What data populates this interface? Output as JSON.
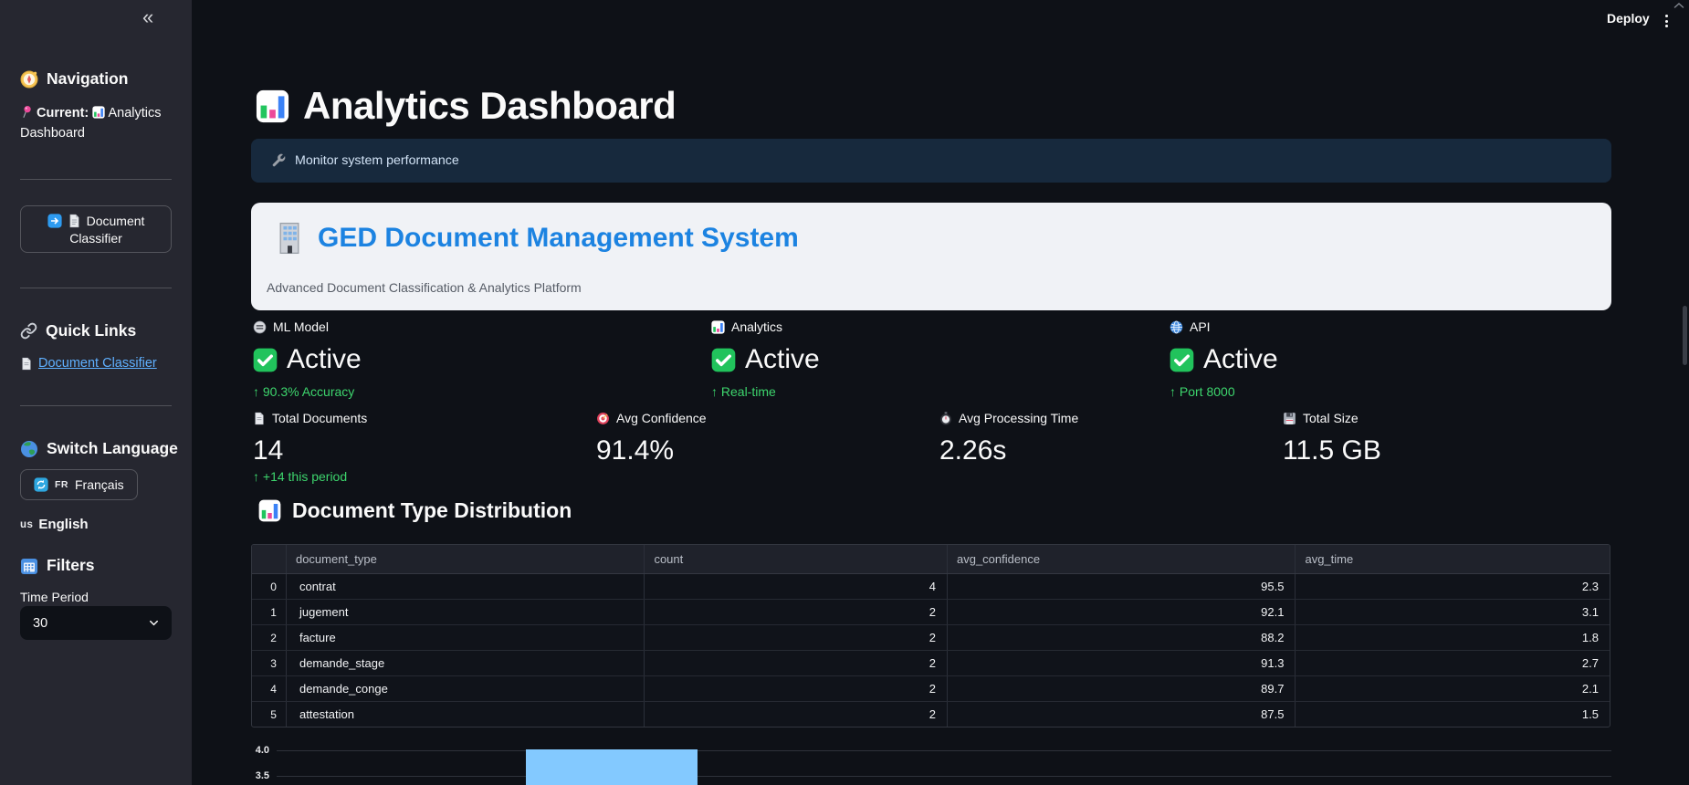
{
  "topbar": {
    "deploy_label": "Deploy"
  },
  "sidebar": {
    "collapse_glyph": "«",
    "navigation_heading": "Navigation",
    "current_label": "Current:",
    "current_value": "Analytics Dashboard",
    "classifier_button_line1": "Document",
    "classifier_button_line2": "Classifier",
    "quick_links_heading": "Quick Links",
    "quick_link_text": "Document Classifier",
    "language_heading": "Switch Language",
    "language_button_flag": "FR",
    "language_button_text": "Français",
    "language_current_flag": "us",
    "language_current_text": "English",
    "filters_heading": "Filters",
    "time_period_label": "Time Period",
    "time_period_value": "30"
  },
  "main": {
    "title": "Analytics Dashboard",
    "info_banner": "Monitor system performance",
    "hero_title": "GED Document Management System",
    "hero_subtitle": "Advanced Document Classification & Analytics Platform",
    "status_cards": [
      {
        "label": "ML Model",
        "value": "Active",
        "delta": "↑ 90.3% Accuracy"
      },
      {
        "label": "Analytics",
        "value": "Active",
        "delta": "↑ Real-time"
      },
      {
        "label": "API",
        "value": "Active",
        "delta": "↑ Port 8000"
      }
    ],
    "metrics": [
      {
        "label": "Total Documents",
        "value": "14",
        "delta": "↑ +14 this period"
      },
      {
        "label": "Avg Confidence",
        "value": "91.4%"
      },
      {
        "label": "Avg Processing Time",
        "value": "2.26s"
      },
      {
        "label": "Total Size",
        "value": "11.5 GB"
      }
    ],
    "section_heading": "Document Type Distribution",
    "table": {
      "columns": [
        "document_type",
        "count",
        "avg_confidence",
        "avg_time"
      ],
      "rows": [
        {
          "index": "0",
          "document_type": "contrat",
          "count": "4",
          "avg_confidence": "95.5",
          "avg_time": "2.3"
        },
        {
          "index": "1",
          "document_type": "jugement",
          "count": "2",
          "avg_confidence": "92.1",
          "avg_time": "3.1"
        },
        {
          "index": "2",
          "document_type": "facture",
          "count": "2",
          "avg_confidence": "88.2",
          "avg_time": "1.8"
        },
        {
          "index": "3",
          "document_type": "demande_stage",
          "count": "2",
          "avg_confidence": "91.3",
          "avg_time": "2.7"
        },
        {
          "index": "4",
          "document_type": "demande_conge",
          "count": "2",
          "avg_confidence": "89.7",
          "avg_time": "2.1"
        },
        {
          "index": "5",
          "document_type": "attestation",
          "count": "2",
          "avg_confidence": "87.5",
          "avg_time": "1.5"
        }
      ]
    },
    "chart_ticks": [
      "4.0",
      "3.5"
    ]
  },
  "chart_data": {
    "type": "bar",
    "note": "bar chart cut off at bottom edge of screenshot; only top of tallest bar visible",
    "visible_y_ticks": [
      4.0,
      3.5
    ],
    "visible_bar_values": [
      4
    ],
    "bar_color": "#83c9ff",
    "grid": true
  },
  "icons": {
    "collapse": "«",
    "navigation": "compass 🧭",
    "current-pin": "round pushpin 📍",
    "bar-chart": "bar chart 📊",
    "arrow-right": "right arrow ➡️",
    "document": "page 📄",
    "quick-links": "link 🔗",
    "globe": "globe 🌍",
    "refresh": "arrows 🔄",
    "calendar": "calendar 📅",
    "ml-model": "robot 🤖",
    "api": "globe with meridians 🌐",
    "active-check": "check mark ✅",
    "target": "bullseye 🎯",
    "stopwatch": "stopwatch ⏱️",
    "floppy": "floppy disk 💾",
    "building": "office building 🏢",
    "wrench": "wrench 🔧",
    "kebab-menu": "⋮",
    "chevron-down": "˅"
  },
  "colors": {
    "background": "#0e1117",
    "sidebar": "#262730",
    "hero_card_bg": "#f0f2f6",
    "hero_title_blue": "#1c83e1",
    "link_blue": "#5fb0ff",
    "success_green": "#3dd56d",
    "bar_fill": "#83c9ff",
    "info_banner_bg": "#17293d"
  }
}
